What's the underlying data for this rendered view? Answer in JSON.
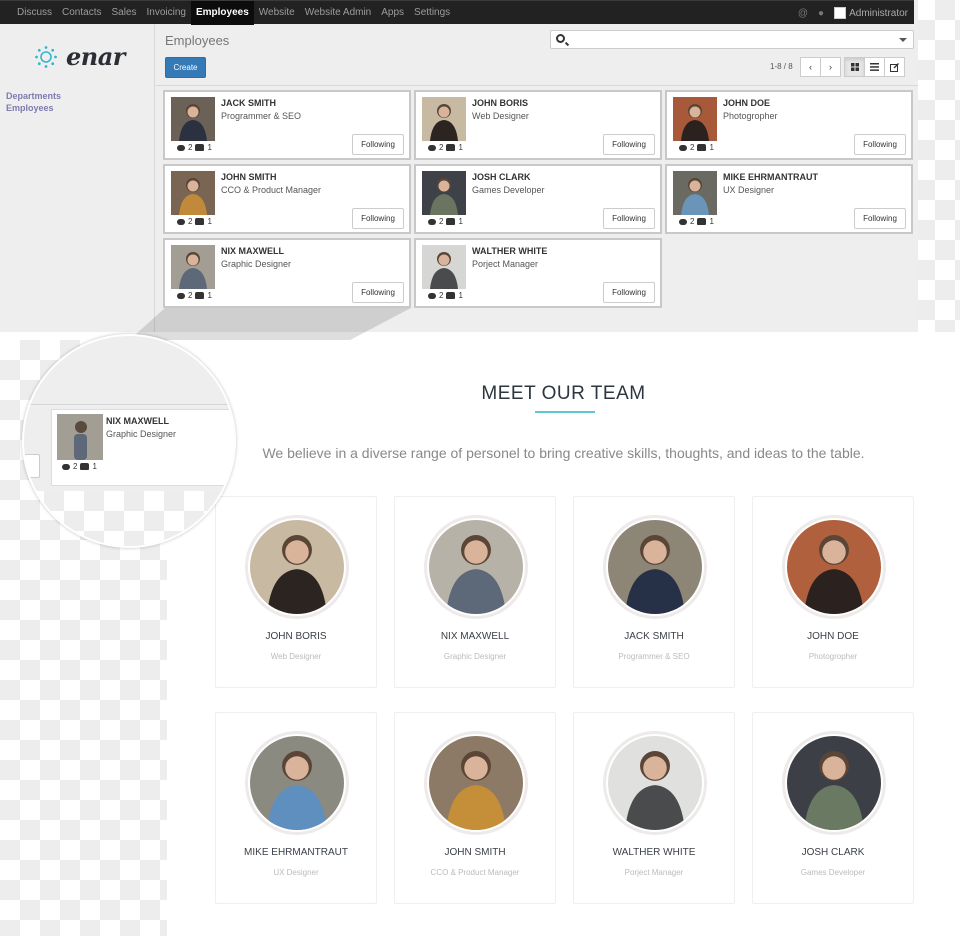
{
  "topbar": {
    "menu": [
      "Discuss",
      "Contacts",
      "Sales",
      "Invoicing",
      "Employees",
      "Website",
      "Website Admin",
      "Apps",
      "Settings"
    ],
    "active_menu": "Employees",
    "user": "Administrator",
    "icons": [
      "at-icon",
      "chat-bubbles-icon"
    ]
  },
  "sidebar": {
    "logo_text": "enar",
    "links": [
      "Departments",
      "Employees"
    ]
  },
  "control_panel": {
    "title": "Employees",
    "create_label": "Create",
    "search_placeholder": "",
    "pager": "1-8 / 8",
    "views": [
      "kanban-view",
      "list-view",
      "form-view"
    ],
    "active_view": "kanban-view"
  },
  "kanban": {
    "follow_label": "Following",
    "employees": [
      {
        "name": "JACK SMITH",
        "job": "Programmer & SEO",
        "messages": "2",
        "followers": "1",
        "photo_colors": [
          "#6b6156",
          "#2b3140"
        ]
      },
      {
        "name": "JOHN BORIS",
        "job": "Web Designer",
        "messages": "2",
        "followers": "1",
        "photo_colors": [
          "#c8b9a3",
          "#2c2420"
        ]
      },
      {
        "name": "JOHN DOE",
        "job": "Photogropher",
        "messages": "2",
        "followers": "1",
        "photo_colors": [
          "#a8593a",
          "#2b2220"
        ]
      },
      {
        "name": "JOHN SMITH",
        "job": "CCO & Product Manager",
        "messages": "2",
        "followers": "1",
        "photo_colors": [
          "#7a6452",
          "#c08a3a"
        ]
      },
      {
        "name": "JOSH CLARK",
        "job": "Games Developer",
        "messages": "2",
        "followers": "1",
        "photo_colors": [
          "#3e4248",
          "#6a7460"
        ]
      },
      {
        "name": "MIKE EHRMANTRAUT",
        "job": "UX Designer",
        "messages": "2",
        "followers": "1",
        "photo_colors": [
          "#6a6a62",
          "#6a94b8"
        ]
      },
      {
        "name": "NIX MAXWELL",
        "job": "Graphic Designer",
        "messages": "2",
        "followers": "1",
        "photo_colors": [
          "#a39e93",
          "#5d6878"
        ]
      },
      {
        "name": "WALTHER WHITE",
        "job": "Porject Manager",
        "messages": "2",
        "followers": "1",
        "photo_colors": [
          "#d6d6d4",
          "#4a4b4c"
        ]
      }
    ]
  },
  "magnifier": {
    "name": "NIX MAXWELL",
    "job": "Graphic Designer",
    "messages": "2",
    "followers": "1"
  },
  "team": {
    "title": "MEET OUR TEAM",
    "accent_color": "#5ec7d3",
    "description": "We believe in a diverse range of personel to bring creative skills, thoughts, and ideas to the table.",
    "members": [
      {
        "name": "JOHN BORIS",
        "job": "Web Designer",
        "photo_colors": [
          "#c8b9a3",
          "#2c2420"
        ]
      },
      {
        "name": "NIX MAXWELL",
        "job": "Graphic Designer",
        "photo_colors": [
          "#b7b2a8",
          "#5d6878"
        ]
      },
      {
        "name": "JACK SMITH",
        "job": "Programmer & SEO",
        "photo_colors": [
          "#8d8677",
          "#263046"
        ]
      },
      {
        "name": "JOHN DOE",
        "job": "Photogropher",
        "photo_colors": [
          "#b0603c",
          "#2b2220"
        ]
      },
      {
        "name": "MIKE EHRMANTRAUT",
        "job": "UX Designer",
        "photo_colors": [
          "#8a8a80",
          "#5f8fbf"
        ]
      },
      {
        "name": "JOHN SMITH",
        "job": "CCO & Product Manager",
        "photo_colors": [
          "#8d7a66",
          "#c58e38"
        ]
      },
      {
        "name": "WALTHER WHITE",
        "job": "Porject Manager",
        "photo_colors": [
          "#e0e0de",
          "#4a4b4c"
        ]
      },
      {
        "name": "JOSH CLARK",
        "job": "Games Developer",
        "photo_colors": [
          "#3c4046",
          "#6a7a62"
        ]
      }
    ]
  }
}
